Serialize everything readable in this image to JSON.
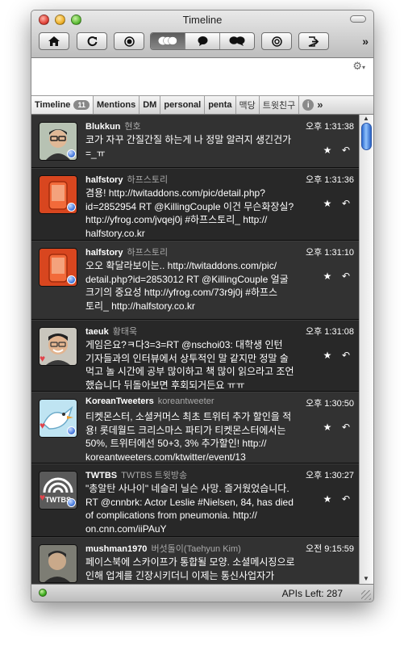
{
  "window": {
    "title": "Timeline"
  },
  "toolbar": {
    "buttons": [
      {
        "name": "home-icon",
        "glyph": "⌂"
      },
      {
        "name": "refresh-icon",
        "glyph": "↻"
      },
      {
        "name": "record-icon",
        "glyph": "◉"
      }
    ],
    "view_modes": [
      {
        "name": "conversation-view-icon",
        "glyph": "❝❞",
        "active": true
      },
      {
        "name": "single-bubble-icon",
        "glyph": "●"
      },
      {
        "name": "double-bubble-icon",
        "glyph": "●●"
      }
    ],
    "right_buttons": [
      {
        "name": "target-icon",
        "glyph": "◎"
      },
      {
        "name": "signout-icon",
        "glyph": "⇥"
      }
    ],
    "overflow_label": "»"
  },
  "compose": {
    "gear_label": "⚙",
    "gear_caret": "▾"
  },
  "tabs": {
    "items": [
      {
        "label": "Timeline",
        "badge": "11",
        "selected": true
      },
      {
        "label": "Mentions"
      },
      {
        "label": "DM"
      },
      {
        "label": "personal"
      },
      {
        "label": "penta"
      },
      {
        "label": "맥당",
        "kr": true
      },
      {
        "label": "트윗친구",
        "kr": true
      }
    ],
    "info_label": "i",
    "more_label": "»"
  },
  "tweets": [
    {
      "name": "Blukkun",
      "screen": "현호",
      "time": "오후 1:31:38",
      "body": "코가 자꾸 간질간질 하는게 나 정말 알러지 생긴건가\n=_ㅠ",
      "avatar": "person-glasses",
      "marker": "dot"
    },
    {
      "name": "halfstory",
      "screen": "하프스토리",
      "time": "오후 1:31:36",
      "body": "겸용! http://twitaddons.com/pic/detail.php?\nid=2852954 RT @KillingCouple 이건 무슨화장실?\nhttp://yfrog.com/jvqej0j #하프스토리_ http://\nhalfstory.co.kr",
      "avatar": "red-phone",
      "marker": "dot"
    },
    {
      "name": "halfstory",
      "screen": "하프스토리",
      "time": "오후 1:31:10",
      "body": "오오 확달라보이는.. http://twitaddons.com/pic/\ndetail.php?id=2853012 RT @KillingCouple 얼굴\n크기의 중요성 http://yfrog.com/73r9j0j #하프스\n토리_ http://halfstory.co.kr",
      "avatar": "red-phone",
      "marker": "dot"
    },
    {
      "name": "taeuk",
      "screen": "황태욱",
      "time": "오후 1:31:08",
      "body": "게임은요?ㅋ다3=3=RT @nschoi03: 대학생 인턴\n기자들과의 인터뷰에서 상투적인 말 같지만 정말 술\n먹고 놀 시간에 공부 많이하고 책 많이 읽으라고 조언\n했습니다 뒤돌아보면 후회되거든요 ㅠㅠ",
      "avatar": "person-smile",
      "marker": "heart"
    },
    {
      "name": "KoreanTweeters",
      "screen": "koreantweeter",
      "time": "오후 1:30:50",
      "body": "티켓몬스터, 소셜커머스 최초 트위터 추가 할인을 적\n용! 롯데월드 크리스마스 파티가 티켓몬스터에서는\n50%, 트위터에선 50+3, 3% 추가할인! http://\nkoreantweeters.com/ktwitter/event/13",
      "avatar": "bird",
      "marker": "dot-heart"
    },
    {
      "name": "TWTBS",
      "screen": "TWTBS 트윗방송",
      "time": "오후 1:30:27",
      "body": "\"총알탄 사나이\" 네슬리 닐슨 사망. 즐거웠었습니다.\nRT @cnnbrk: Actor Leslie #Nielsen, 84, has died\nof complications from pneumonia.  http://\non.cnn.com/iiPAuY",
      "avatar": "twtbs",
      "marker": "dot-heart"
    },
    {
      "name": "mushman1970",
      "screen": "버섯돌이(Taehyun Kim)",
      "time": "오전 9:15:59",
      "body": "페이스북에 스카이프가 통합될 모양. 소셜메시징으로\n인해 업계를 긴장시키더니 이제는 통신사업자가",
      "avatar": "person-dark",
      "marker": "none"
    }
  ],
  "status": {
    "api_text": "APIs Left: 287"
  }
}
